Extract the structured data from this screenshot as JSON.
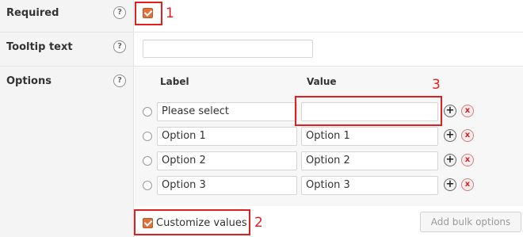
{
  "fields": {
    "required": {
      "label": "Required",
      "help_icon": "?",
      "checked": true
    },
    "tooltip": {
      "label": "Tooltip text",
      "help_icon": "?",
      "value": ""
    },
    "options": {
      "label": "Options",
      "help_icon": "?"
    }
  },
  "options_table": {
    "headers": {
      "label": "Label",
      "value": "Value"
    },
    "rows": [
      {
        "label": "Please select",
        "value": ""
      },
      {
        "label": "Option 1",
        "value": "Option 1"
      },
      {
        "label": "Option 2",
        "value": "Option 2"
      },
      {
        "label": "Option 3",
        "value": "Option 3"
      }
    ],
    "add_icon": "+",
    "remove_icon": "x"
  },
  "footer": {
    "customize_values_label": "Customize values",
    "customize_values_checked": true,
    "add_bulk_label": "Add bulk options"
  },
  "annotations": {
    "one": "1",
    "two": "2",
    "three": "3"
  },
  "colors": {
    "annotation_red": "#e02020",
    "checkbox_orange": "#e0713a",
    "remove_red": "#c0262c"
  }
}
